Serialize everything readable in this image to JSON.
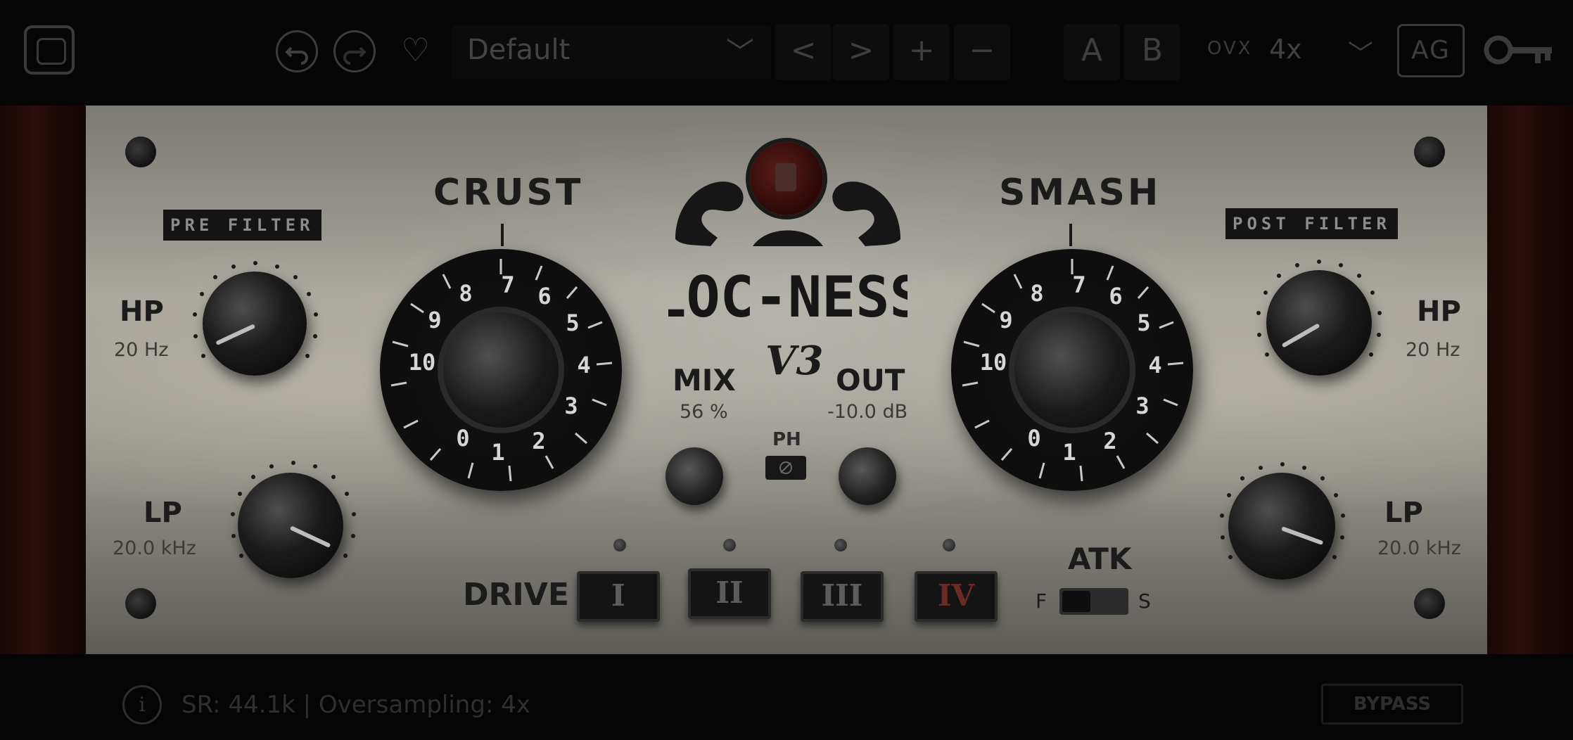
{
  "toolbar": {
    "undo_icon": "undo-arrow-icon",
    "redo_icon": "redo-arrow-icon",
    "preset_name": "Default",
    "preset_dropdown": "﹀",
    "prev": "<",
    "next": ">",
    "plus": "+",
    "minus": "−",
    "a": "A",
    "b": "B",
    "ovx_label": "OVX",
    "ovx_value": "4x",
    "ovx_dropdown": "﹀",
    "ag": "AG"
  },
  "panel": {
    "pre_filter": "PRE FILTER",
    "post_filter": "POST FILTER",
    "crust": "CRUST",
    "smash": "SMASH",
    "logo": "LOC-NESS",
    "version": "V3",
    "mix_label": "MIX",
    "mix_value": "56 %",
    "out_label": "OUT",
    "out_value": "-10.0 dB",
    "ph_label": "PH",
    "left_hp_label": "HP",
    "left_hp_value": "20 Hz",
    "left_lp_label": "LP",
    "left_lp_value": "20.0 kHz",
    "right_hp_label": "HP",
    "right_hp_value": "20 Hz",
    "right_lp_label": "LP",
    "right_lp_value": "20.0 kHz",
    "drive_label": "DRIVE",
    "drive_buttons": [
      "I",
      "II",
      "III",
      "IV"
    ],
    "atk_label": "ATK",
    "atk_f": "F",
    "atk_s": "S",
    "dial_numbers": [
      "0",
      "1",
      "2",
      "3",
      "4",
      "5",
      "6",
      "7",
      "8",
      "9",
      "10"
    ]
  },
  "status": {
    "info": "i",
    "text": "SR: 44.1k | Oversampling: 4x",
    "bypass": "BYPASS"
  }
}
